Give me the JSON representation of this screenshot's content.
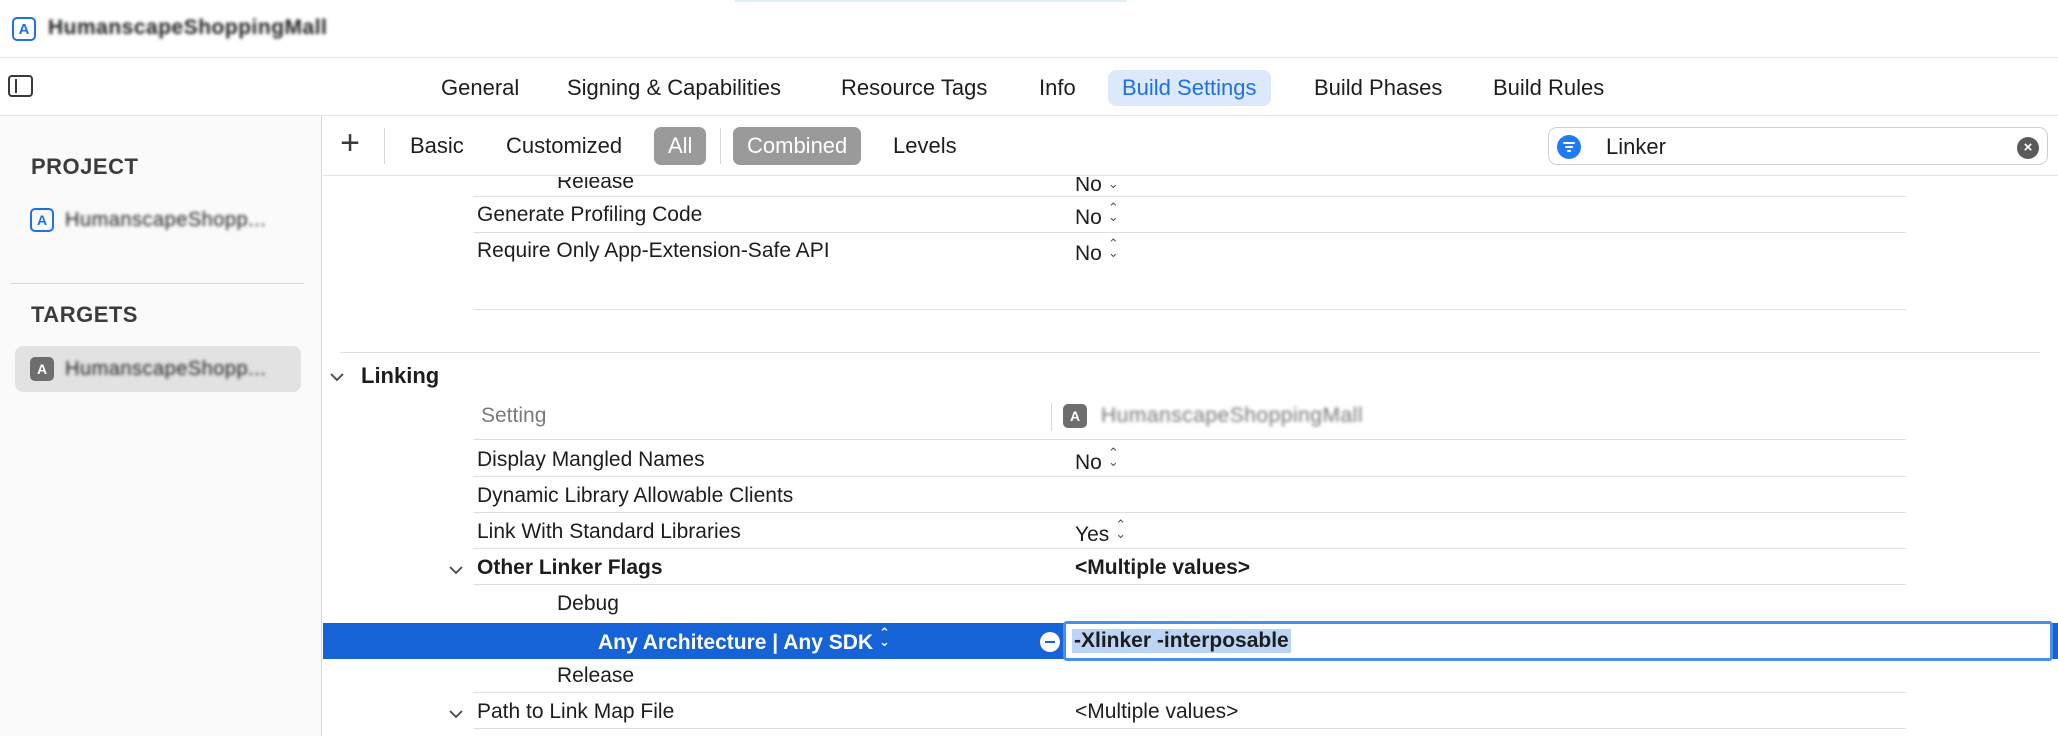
{
  "window": {
    "title": "HumanscapeShoppingMall"
  },
  "tabs": [
    "General",
    "Signing & Capabilities",
    "Resource Tags",
    "Info",
    "Build Settings",
    "Build Phases",
    "Build Rules"
  ],
  "selected_tab": "Build Settings",
  "sidebar": {
    "project_header": "PROJECT",
    "project_item": "HumanscapeShopp...",
    "targets_header": "TARGETS",
    "target_item": "HumanscapeShopp..."
  },
  "filterbar": {
    "add_label": "+",
    "scope": [
      "Basic",
      "Customized",
      "All"
    ],
    "view": [
      "Combined",
      "Levels"
    ],
    "search_value": "Linker"
  },
  "settings": {
    "partial_rows": [
      {
        "name": "Release",
        "value": "No"
      },
      {
        "name": "Generate Profiling Code",
        "value": "No"
      },
      {
        "name": "Require Only App-Extension-Safe API",
        "value": "No"
      }
    ],
    "group": {
      "title": "Linking",
      "column_setting": "Setting",
      "column_target": "HumanscapeShoppingMall",
      "rows": [
        {
          "name": "Display Mangled Names",
          "value": "No"
        },
        {
          "name": "Dynamic Library Allowable Clients",
          "value": ""
        },
        {
          "name": "Link With Standard Libraries",
          "value": "Yes"
        },
        {
          "name": "Other Linker Flags",
          "value": "<Multiple values>"
        },
        {
          "name": "Debug",
          "value": ""
        },
        {
          "name": "Any Architecture | Any SDK",
          "value": "-Xlinker -interposable"
        },
        {
          "name": "Release",
          "value": ""
        },
        {
          "name": "Path to Link Map File",
          "value": "<Multiple values>"
        }
      ]
    }
  },
  "colors": {
    "accent": "#1563d6",
    "tab_selected_bg": "#dce9fb",
    "segment_selected": "#9a9a9a"
  }
}
